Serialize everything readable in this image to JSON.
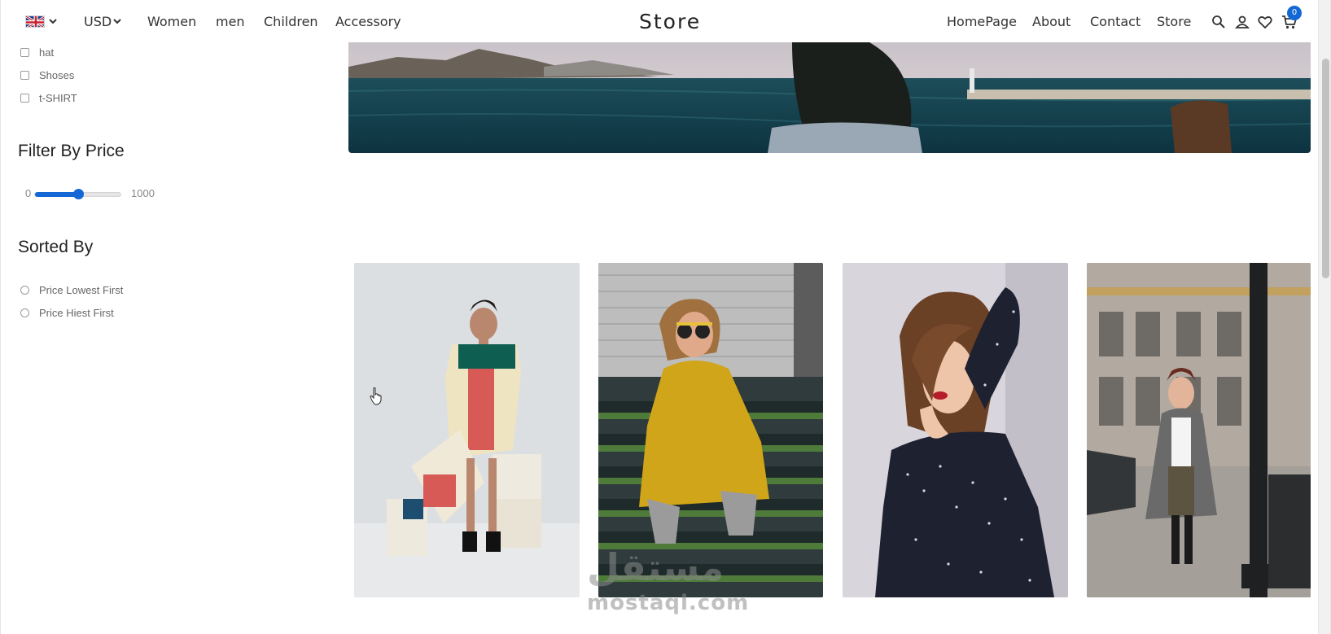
{
  "header": {
    "language_flag": "uk-flag-icon",
    "currency": "USD",
    "left_links": [
      "Women",
      "men",
      "Children",
      "Accessory"
    ],
    "brand": "Store",
    "right_links": [
      "HomePage",
      "About",
      "Contact",
      "Store"
    ],
    "icons": [
      "search-icon",
      "user-icon",
      "heart-icon",
      "cart-icon"
    ],
    "cart_count": "0",
    "accent_color": "#1468d6"
  },
  "sidebar": {
    "categories": [
      {
        "label": "hat",
        "checked": false
      },
      {
        "label": "Shoses",
        "checked": false
      },
      {
        "label": "t-SHIRT",
        "checked": false
      }
    ],
    "price_filter": {
      "heading": "Filter By Price",
      "min_label": "0",
      "max_label": "1000",
      "value_fraction": 0.5
    },
    "sort": {
      "heading": "Sorted By",
      "options": [
        {
          "label": "Price Lowest First",
          "selected": false
        },
        {
          "label": "Price Hiest First",
          "selected": false
        }
      ]
    }
  },
  "banner": {
    "image": "sea-coast-photo"
  },
  "products": [
    {
      "image": "woman-patchwork-dress-photo"
    },
    {
      "image": "woman-yellow-dress-on-stairs-photo"
    },
    {
      "image": "woman-polka-dot-dress-photo"
    },
    {
      "image": "woman-coat-street-photo"
    }
  ],
  "watermark": {
    "arabic": "مستقل",
    "latin": "mostaql.com"
  }
}
